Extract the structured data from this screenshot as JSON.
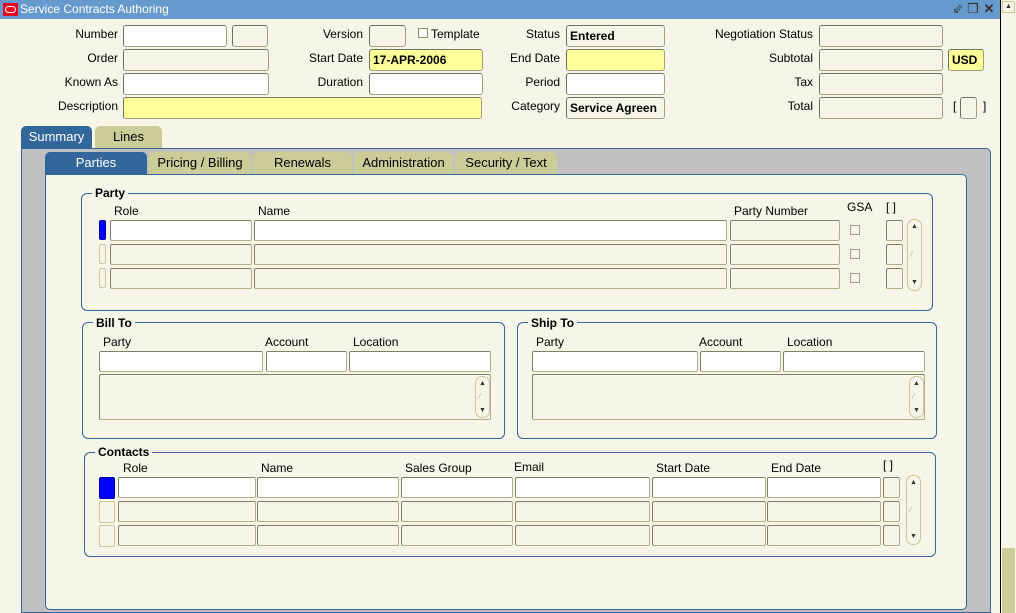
{
  "window": {
    "title": "Service Contracts Authoring",
    "icons": {
      "logo": "oracle-logo-icon",
      "minimize": "minimize-icon",
      "restore": "restore-icon",
      "close": "close-icon"
    },
    "controls": {
      "minimize": "⇙",
      "restore": "❐",
      "close": "✕"
    }
  },
  "header": {
    "number": {
      "label": "Number",
      "value": "",
      "suffix": ""
    },
    "version": {
      "label": "Version",
      "value": ""
    },
    "template": {
      "label": "Template",
      "checked": false
    },
    "order": {
      "label": "Order",
      "value": ""
    },
    "start_date": {
      "label": "Start Date",
      "value": "17-APR-2006"
    },
    "known_as": {
      "label": "Known As",
      "value": ""
    },
    "duration": {
      "label": "Duration",
      "value": ""
    },
    "description": {
      "label": "Description",
      "value": ""
    },
    "status": {
      "label": "Status",
      "value": "Entered"
    },
    "end_date": {
      "label": "End Date",
      "value": ""
    },
    "period": {
      "label": "Period",
      "value": ""
    },
    "category": {
      "label": "Category",
      "value": "Service Agreen"
    },
    "negotiation_status": {
      "label": "Negotiation Status",
      "value": ""
    },
    "subtotal": {
      "label": "Subtotal",
      "value": ""
    },
    "currency": {
      "value": "USD"
    },
    "tax": {
      "label": "Tax",
      "value": ""
    },
    "total": {
      "label": "Total",
      "value": ""
    },
    "descflex": {
      "open": "[",
      "close": "]"
    }
  },
  "tabs": {
    "main": [
      {
        "label": "Summary",
        "active": true
      },
      {
        "label": "Lines",
        "active": false
      }
    ],
    "sub": [
      {
        "label": "Parties",
        "active": true
      },
      {
        "label": "Pricing / Billing",
        "active": false
      },
      {
        "label": "Renewals",
        "active": false
      },
      {
        "label": "Administration",
        "active": false
      },
      {
        "label": "Security / Text",
        "active": false
      }
    ]
  },
  "party": {
    "title": "Party",
    "columns": {
      "role": "Role",
      "name": "Name",
      "party_number": "Party Number",
      "gsa": "GSA",
      "flex": "[ ]"
    },
    "rows": [
      {
        "role": "",
        "name": "",
        "party_number": "",
        "gsa": false
      },
      {
        "role": "",
        "name": "",
        "party_number": "",
        "gsa": false
      },
      {
        "role": "",
        "name": "",
        "party_number": "",
        "gsa": false
      }
    ]
  },
  "bill_to": {
    "title": "Bill To",
    "columns": {
      "party": "Party",
      "account": "Account",
      "location": "Location"
    },
    "values": {
      "party": "",
      "account": "",
      "location": "",
      "address": ""
    }
  },
  "ship_to": {
    "title": "Ship To",
    "columns": {
      "party": "Party",
      "account": "Account",
      "location": "Location"
    },
    "values": {
      "party": "",
      "account": "",
      "location": "",
      "address": ""
    }
  },
  "contacts": {
    "title": "Contacts",
    "columns": {
      "role": "Role",
      "name": "Name",
      "sales_group": "Sales Group",
      "email": "Email",
      "start_date": "Start Date",
      "end_date": "End Date",
      "flex": "[ ]"
    },
    "rows": [
      {
        "role": "",
        "name": "",
        "sales_group": "",
        "email": "",
        "start_date": "",
        "end_date": ""
      },
      {
        "role": "",
        "name": "",
        "sales_group": "",
        "email": "",
        "start_date": "",
        "end_date": ""
      },
      {
        "role": "",
        "name": "",
        "sales_group": "",
        "email": "",
        "start_date": "",
        "end_date": ""
      }
    ]
  },
  "scroll_glyphs": {
    "up": "▲",
    "down": "▼",
    "mid": "⁄"
  }
}
